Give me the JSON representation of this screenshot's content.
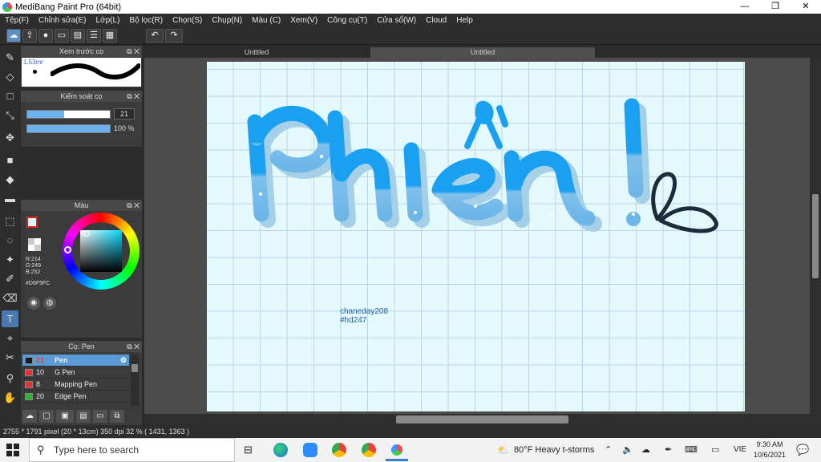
{
  "window": {
    "title": "MediBang Paint Pro (64bit)",
    "minimize": "—",
    "maximize": "❐",
    "close": "✕"
  },
  "menu": [
    "Tệp(F)",
    "Chỉnh sửa(E)",
    "Lớp(L)",
    "Bộ lọc(R)",
    "Chọn(S)",
    "Chụp(N)",
    "Màu (C)",
    "Xem(V)",
    "Công cụ(T)",
    "Cửa sổ(W)",
    "Cloud",
    "Help"
  ],
  "tabs": {
    "tab1": "Untitled",
    "tab2": "Untitled"
  },
  "panels": {
    "brush_preview": {
      "title": "Xem trước cọ",
      "size_label": "1.53mr"
    },
    "brush_control": {
      "title": "Kiểm soát cọ",
      "size_value": "21",
      "opacity_value": "100 %",
      "size_fill": 0.45,
      "opacity_fill": 1.0
    },
    "color": {
      "title": "Màu",
      "r": "R:214",
      "g": "G:249",
      "b": "B:252",
      "hex": "#D6F9FC",
      "primary": "#d6f9fc"
    },
    "brush_list": {
      "title": "Cọ: Pen",
      "items": [
        {
          "num": "21",
          "name": "Pen",
          "color": "#1a1a1a"
        },
        {
          "num": "10",
          "name": "G Pen",
          "color": "#e83030"
        },
        {
          "num": "8",
          "name": "Mapping Pen",
          "color": "#e83030"
        },
        {
          "num": "20",
          "name": "Edge Pen",
          "color": "#2db52d"
        }
      ]
    }
  },
  "canvas": {
    "lettering": "Phiền!",
    "credit_line1": "chaneday208",
    "credit_line2": "#hd247",
    "lettering_color": "#1aa0f0"
  },
  "status": {
    "text": "2755 * 1791 pixel   (20 * 13cm)   350 dpi   32 %   ( 1431, 1363 )"
  },
  "taskbar": {
    "search_placeholder": "Type here to search",
    "weather": "80°F  Heavy t-storms",
    "lang": "VIE",
    "time": "9:30 AM",
    "date": "10/6/2021"
  }
}
